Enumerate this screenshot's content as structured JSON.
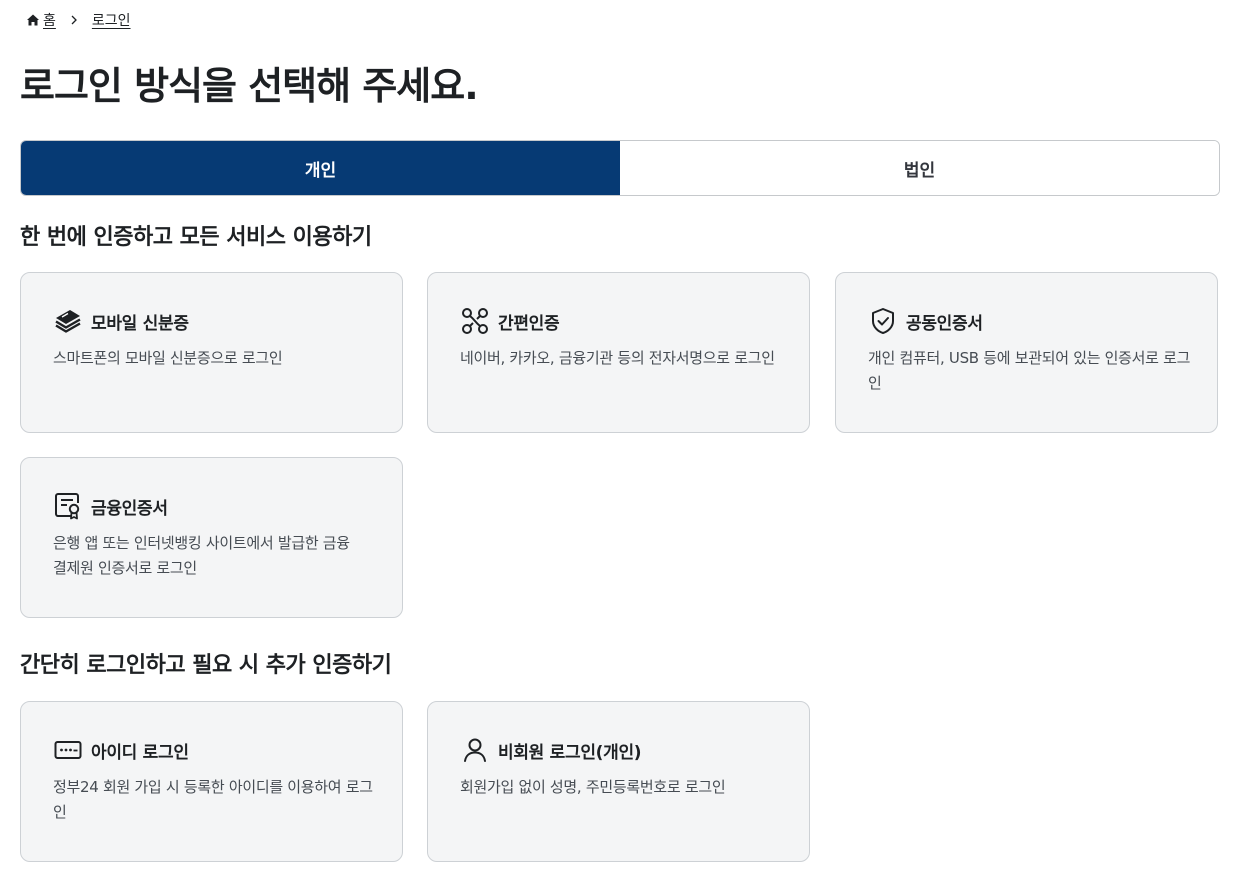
{
  "breadcrumb": {
    "home": "홈",
    "current": "로그인"
  },
  "title": "로그인 방식을 선택해 주세요.",
  "tabs": [
    {
      "label": "개인",
      "active": true
    },
    {
      "label": "법인",
      "active": false
    }
  ],
  "section1": {
    "heading": "한 번에 인증하고 모든 서비스 이용하기",
    "cards": [
      {
        "title": "모바일 신분증",
        "desc": "스마트폰의 모바일 신분증으로 로그인",
        "icon": "mobile-id-icon"
      },
      {
        "title": "간편인증",
        "desc": "네이버, 카카오, 금융기관 등의 전자서명으로 로그인",
        "icon": "simple-auth-icon"
      },
      {
        "title": "공동인증서",
        "desc": "개인 컴퓨터, USB 등에 보관되어 있는 인증서로 로그인",
        "icon": "shield-check-icon"
      },
      {
        "title": "금융인증서",
        "desc": "은행 앱 또는 인터넷뱅킹 사이트에서 발급한 금융결제원 인증서로 로그인",
        "icon": "certificate-icon"
      }
    ]
  },
  "section2": {
    "heading": "간단히 로그인하고 필요 시 추가 인증하기",
    "cards": [
      {
        "title": "아이디 로그인",
        "desc": "정부24 회원 가입 시 등록한 아이디를 이용하여 로그인",
        "icon": "password-field-icon"
      },
      {
        "title": "비회원 로그인(개인)",
        "desc": "회원가입 없이 성명, 주민등록번호로 로그인",
        "icon": "person-icon"
      }
    ]
  },
  "colors": {
    "primary": "#063a74",
    "card_bg": "#f4f5f6",
    "card_border": "#cdd1d5",
    "text": "#1e2124",
    "desc_text": "#464c53"
  }
}
